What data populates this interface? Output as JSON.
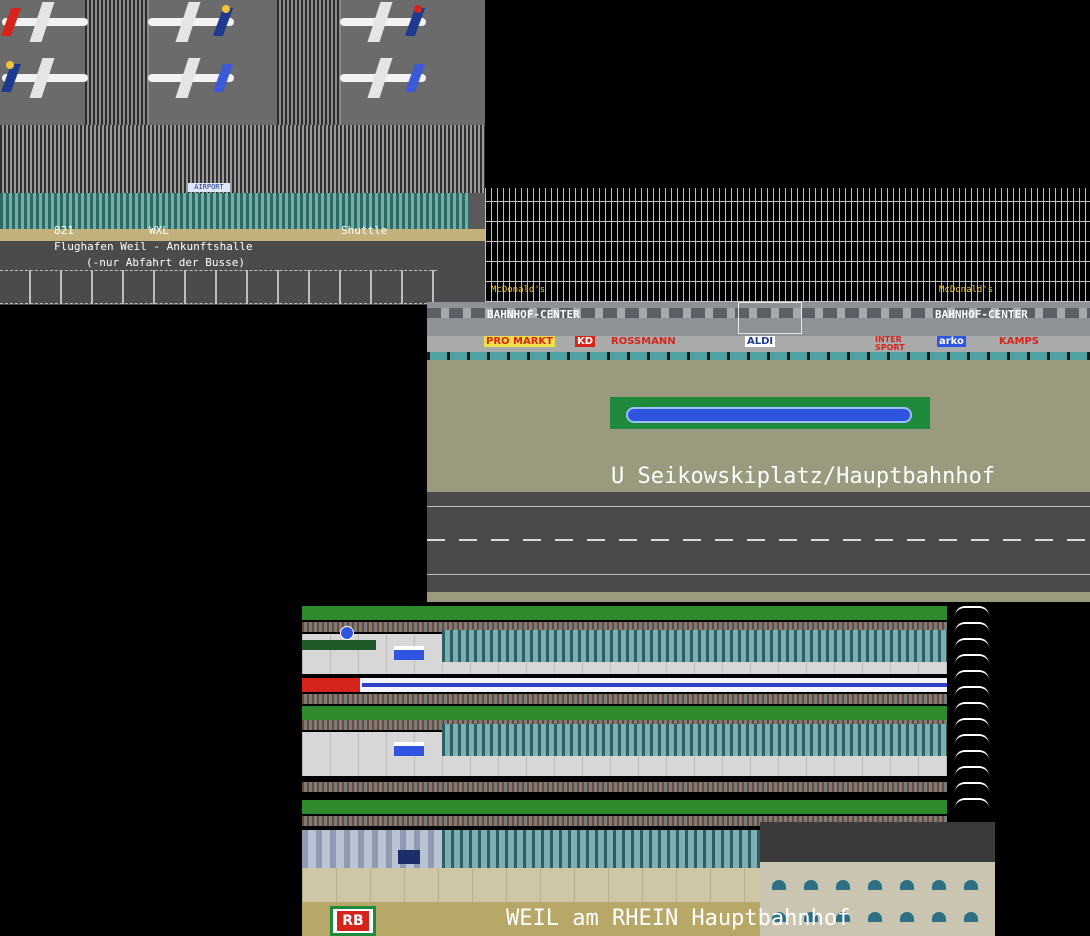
{
  "airport": {
    "sign": "AIRPORT",
    "bus_label_1": "821",
    "bus_label_2": "WXL",
    "shuttle_label": "Shuttle",
    "hall_name": "Flughafen Weil - Ankunftshalle",
    "hall_note": "(-nur Abfahrt der Busse)"
  },
  "station_center": {
    "mcdonalds_left": "McDonald's",
    "mcdonalds_right": "McDonald's",
    "name_left": "BAHNHOF-CENTER",
    "name_right": "BAHNHOF-CENTER",
    "shops": [
      {
        "label": "PRO MARKT",
        "color": "#d6241c",
        "bg": "#f2e04a"
      },
      {
        "label": "KD",
        "color": "#ffffff",
        "bg": "#d6241c"
      },
      {
        "label": "ROSSMANN",
        "color": "#d6241c",
        "bg": ""
      },
      {
        "label": "ALDI",
        "color": "#1d3a8f",
        "bg": "#ffffff"
      },
      {
        "label": "INTER SPORT",
        "color": "#d6241c",
        "bg": ""
      },
      {
        "label": "arko",
        "color": "#ffffff",
        "bg": "#2f55e0"
      },
      {
        "label": "KAMPS",
        "color": "#d6241c",
        "bg": ""
      }
    ],
    "stop_name": "U Seikowskiplatz/Hauptbahnhof"
  },
  "railway": {
    "operator_logo": "RB",
    "station_name": "WEIL am RHEIN Hauptbahnhof"
  },
  "colors": {
    "grass": "#2d8a2d",
    "water": "#2f55e0",
    "loco": "#d6241c"
  }
}
